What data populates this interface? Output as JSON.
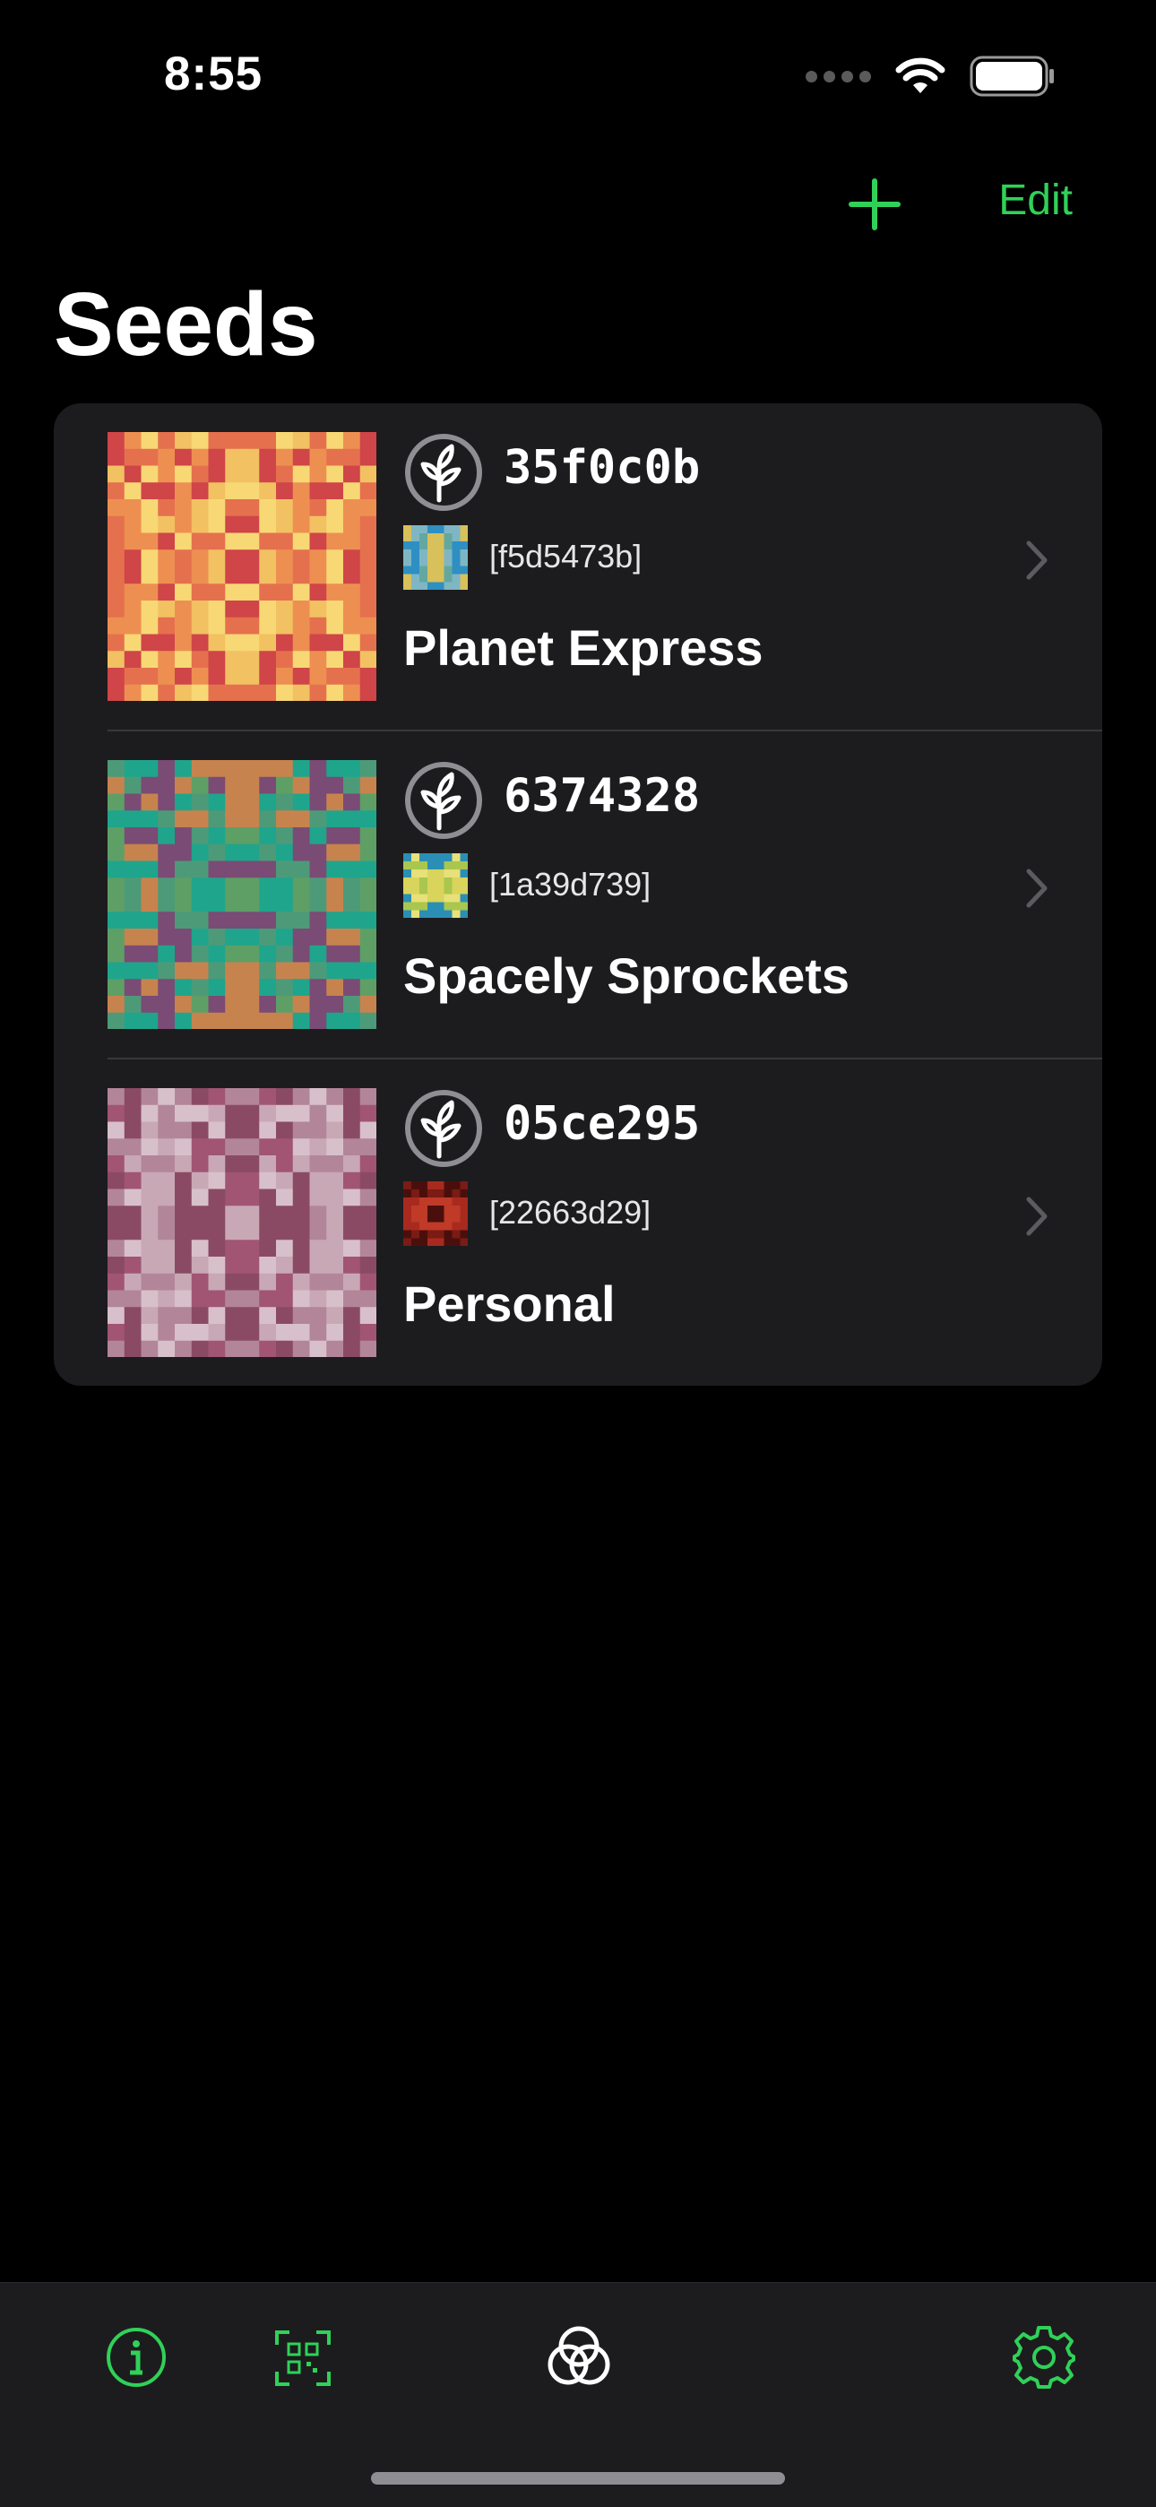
{
  "status_bar": {
    "time": "8:55"
  },
  "nav": {
    "add_label": "+",
    "edit_label": "Edit",
    "title": "Seeds"
  },
  "seeds": [
    {
      "id": "35f0c0b",
      "secondary_id": "[f5d5473b]",
      "name": "Planet Express",
      "palette": [
        "#f2c162",
        "#ee8f52",
        "#cf4548",
        "#e5704e",
        "#f7d874"
      ],
      "small_palette": [
        "#7fb6c4",
        "#2e8fc2",
        "#d8c05a",
        "#63a8a0"
      ]
    },
    {
      "id": "6374328",
      "secondary_id": "[1a39d739]",
      "name": "Spacely Sprockets",
      "palette": [
        "#1fa58c",
        "#4d9a79",
        "#c7834e",
        "#7a4b74",
        "#5e9f66"
      ],
      "small_palette": [
        "#d9d45c",
        "#2b8fb5",
        "#a9c64e",
        "#e8e078"
      ]
    },
    {
      "id": "05ce295",
      "secondary_id": "[22663d29]",
      "name": "Personal",
      "palette": [
        "#c9a8b6",
        "#b28698",
        "#a15573",
        "#d8c0ca",
        "#8b4a63"
      ],
      "small_palette": [
        "#7a1b14",
        "#a82a1f",
        "#4a0f0c",
        "#c03a28"
      ]
    }
  ],
  "colors": {
    "accent": "#30d158",
    "card": "#1c1c1e",
    "background": "#000000"
  },
  "tabbar": {
    "items": [
      {
        "icon": "info-icon"
      },
      {
        "icon": "qr-scan-icon"
      },
      {
        "icon": "blockchain-commons-logo-icon"
      },
      {
        "icon": "gear-icon"
      }
    ]
  }
}
